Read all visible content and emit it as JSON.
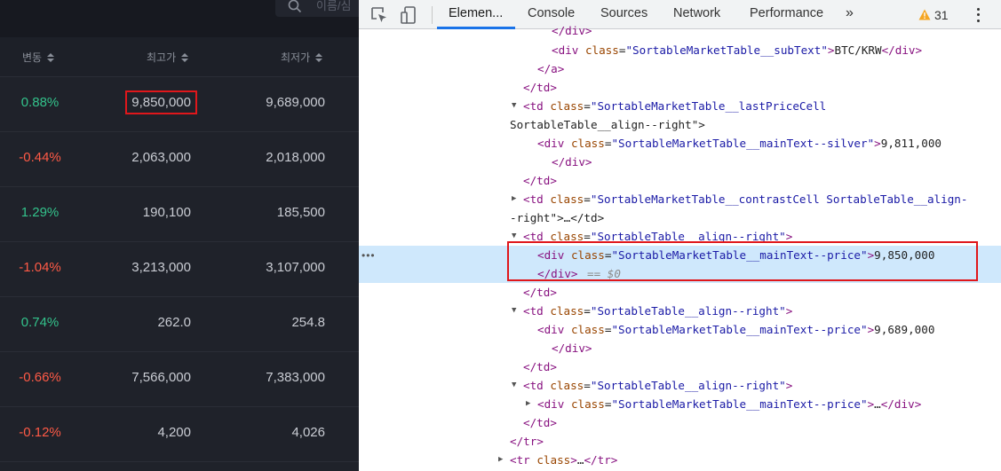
{
  "search": {
    "placeholder": "이름/심"
  },
  "table": {
    "headers": {
      "change": "변동",
      "high": "최고가",
      "low": "최저가"
    },
    "rows": [
      {
        "change": "0.88%",
        "dir": "up",
        "high": "9,850,000",
        "low": "9,689,000"
      },
      {
        "change": "-0.44%",
        "dir": "down",
        "high": "2,063,000",
        "low": "2,018,000"
      },
      {
        "change": "1.29%",
        "dir": "up",
        "high": "190,100",
        "low": "185,500"
      },
      {
        "change": "-1.04%",
        "dir": "down",
        "high": "3,213,000",
        "low": "3,107,000"
      },
      {
        "change": "0.74%",
        "dir": "up",
        "high": "262.0",
        "low": "254.8"
      },
      {
        "change": "-0.66%",
        "dir": "down",
        "high": "7,566,000",
        "low": "7,383,000"
      },
      {
        "change": "-0.12%",
        "dir": "down",
        "high": "4,200",
        "low": "4,026"
      }
    ]
  },
  "devtools": {
    "tabs": [
      "Elemen...",
      "Console",
      "Sources",
      "Network",
      "Performance"
    ],
    "more": "»",
    "warnings": "31",
    "dom_lines": [
      {
        "c": "</div>"
      },
      {
        "c": "<div class=\"SortableMarketTable__subText\">BTC/KRW</div>"
      },
      {
        "c": "</a>"
      },
      {
        "c": "</td>"
      },
      {
        "c": "<td class=\"SortableMarketTable__lastPriceCell"
      },
      {
        "c": "SortableTable__align--right\">"
      },
      {
        "c": "<div class=\"SortableMarketTable__mainText--silver\">9,811,000"
      },
      {
        "c": "</div>"
      },
      {
        "c": "</td>"
      },
      {
        "c": "<td class=\"SortableMarketTable__contrastCell SortableTable__align-"
      },
      {
        "c": "-right\">…</td>"
      },
      {
        "c": "<td class=\"SortableTable__align--right\">"
      },
      {
        "c": "<div class=\"SortableMarketTable__mainText--price\">9,850,000"
      },
      {
        "c": "</div>",
        "s": "== $0"
      },
      {
        "c": "</td>"
      },
      {
        "c": "<td class=\"SortableTable__align--right\">"
      },
      {
        "c": "<div class=\"SortableMarketTable__mainText--price\">9,689,000"
      },
      {
        "c": "</div>"
      },
      {
        "c": "</td>"
      },
      {
        "c": "<td class=\"SortableTable__align--right\">"
      },
      {
        "c": "<div class=\"SortableMarketTable__mainText--price\">…</div>"
      },
      {
        "c": "</td>"
      },
      {
        "c": "</tr>"
      },
      {
        "c": "<tr class>…</tr>"
      }
    ]
  }
}
